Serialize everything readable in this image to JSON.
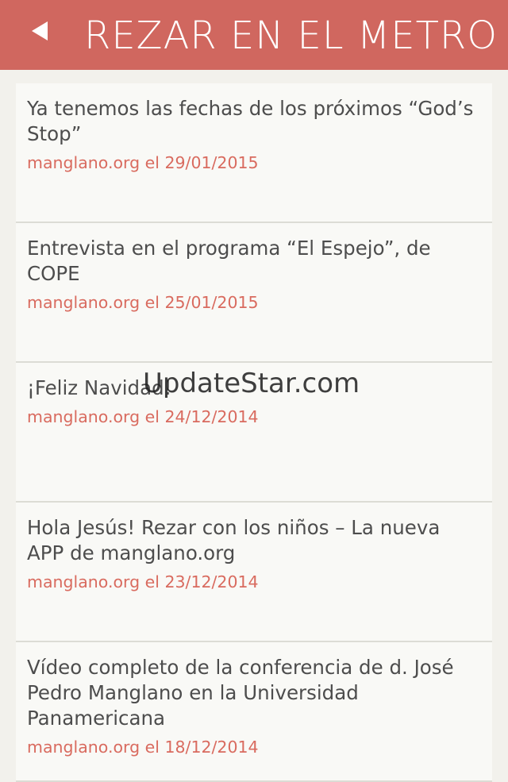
{
  "header": {
    "title": "REZAR EN EL METRO",
    "back_icon": "chevron-left-icon",
    "background_color": "#d0675f"
  },
  "articles": [
    {
      "title": "Ya tenemos las fechas de los próximos “God’s Stop”",
      "meta": "manglano.org el 29/01/2015"
    },
    {
      "title": "Entrevista en el programa “El Espejo”, de COPE",
      "meta": "manglano.org el 25/01/2015"
    },
    {
      "title": "¡Feliz Navidad!",
      "meta": "manglano.org el 24/12/2014"
    },
    {
      "title": "Hola Jesús! Rezar con los niños – La nueva APP de manglano.org",
      "meta": "manglano.org el 23/12/2014"
    },
    {
      "title": "Vídeo completo de la conferencia de d. José Pedro Manglano en la Universidad Panamericana",
      "meta": "manglano.org el 18/12/2014"
    }
  ],
  "watermark": "UpdateStar.com",
  "colors": {
    "accent": "#d0675f",
    "meta_text": "#d96b5f",
    "title_text": "#4d4d4d"
  }
}
